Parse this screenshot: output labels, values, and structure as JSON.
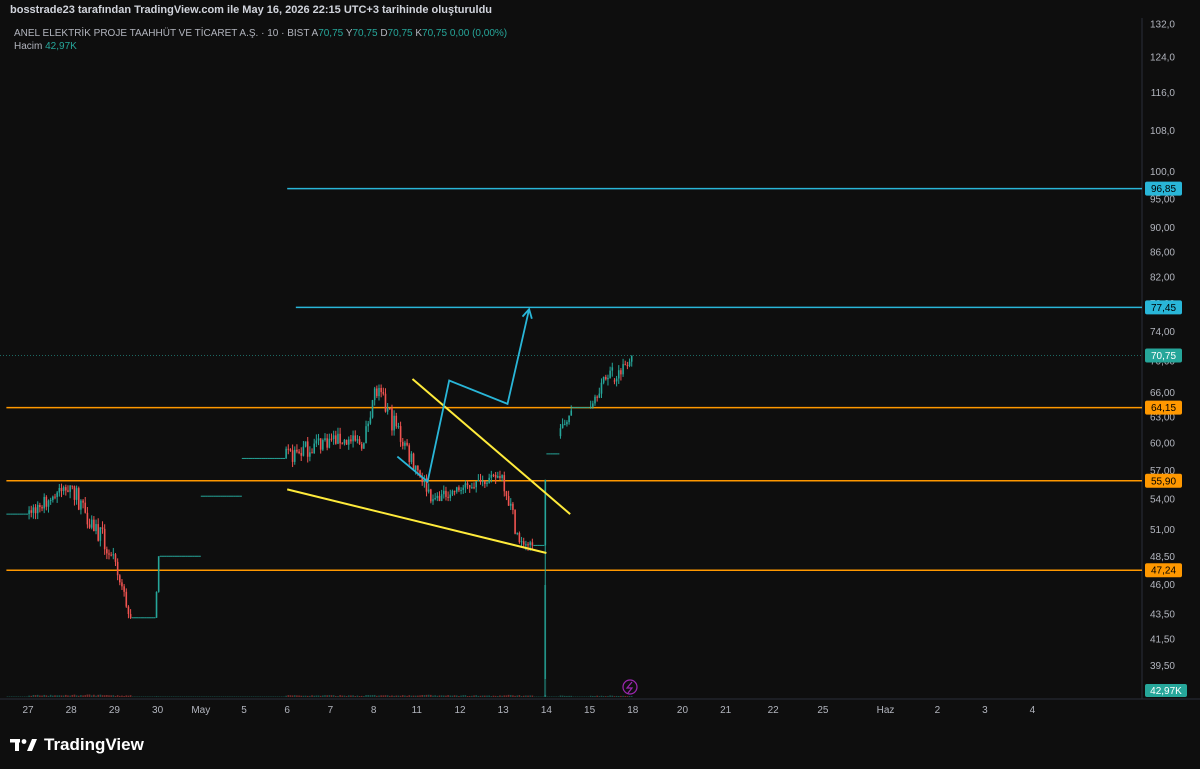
{
  "header": {
    "created_by": "bosstrade23 tarafından TradingView.com ile May 16, 2026 22:15 UTC+3 tarihinde oluşturuldu"
  },
  "legend": {
    "symbol": "ANEL ELEKTRİK PROJE TAAHHÜT VE TİCARET A.Ş. · 10 · BIST",
    "open_label": "A",
    "open": "70,75",
    "high_label": "Y",
    "high": "70,75",
    "low_label": "D",
    "low": "70,75",
    "close_label": "K",
    "close": "70,75",
    "change": "0,00 (0,00%)",
    "volume_label": "Hacim",
    "volume": "42,97K"
  },
  "logo": {
    "text": "TradingView"
  },
  "colors": {
    "background": "#0e0e0e",
    "up": "#26a69a",
    "down": "#ef5350",
    "support_line": "#ff9800",
    "target_line": "#29b6d8",
    "wedge": "#ffeb3b",
    "projection": "#29b6d8"
  },
  "chart_data": {
    "type": "candlestick",
    "symbol": "ANEL",
    "interval": "10",
    "exchange": "BIST",
    "y_scale": "log",
    "ylim": [
      38.5,
      133
    ],
    "y_ticks": [
      {
        "value": 132,
        "label": "132,0"
      },
      {
        "value": 124,
        "label": "124,0"
      },
      {
        "value": 116,
        "label": "116,0"
      },
      {
        "value": 108,
        "label": "108,0"
      },
      {
        "value": 100,
        "label": "100,0"
      },
      {
        "value": 95,
        "label": "95,00"
      },
      {
        "value": 90,
        "label": "90,00"
      },
      {
        "value": 86,
        "label": "86,00"
      },
      {
        "value": 82,
        "label": "82,00"
      },
      {
        "value": 78,
        "label": "78,00"
      },
      {
        "value": 74,
        "label": "74,00"
      },
      {
        "value": 70,
        "label": "70,00"
      },
      {
        "value": 66,
        "label": "66,00"
      },
      {
        "value": 63,
        "label": "63,00"
      },
      {
        "value": 60,
        "label": "60,00"
      },
      {
        "value": 57,
        "label": "57,00"
      },
      {
        "value": 54,
        "label": "54,00"
      },
      {
        "value": 51,
        "label": "51,00"
      },
      {
        "value": 48.5,
        "label": "48,50"
      },
      {
        "value": 46,
        "label": "46,00"
      },
      {
        "value": 43.5,
        "label": "43,50"
      },
      {
        "value": 41.5,
        "label": "41,50"
      },
      {
        "value": 39.5,
        "label": "39,50"
      }
    ],
    "x_ticks": [
      {
        "t": 0,
        "label": "27"
      },
      {
        "t": 1,
        "label": "28"
      },
      {
        "t": 2,
        "label": "29"
      },
      {
        "t": 3,
        "label": "30"
      },
      {
        "t": 4,
        "label": "May"
      },
      {
        "t": 5,
        "label": "5"
      },
      {
        "t": 6,
        "label": "6"
      },
      {
        "t": 7,
        "label": "7"
      },
      {
        "t": 8,
        "label": "8"
      },
      {
        "t": 9,
        "label": "11"
      },
      {
        "t": 10,
        "label": "12"
      },
      {
        "t": 11,
        "label": "13"
      },
      {
        "t": 12,
        "label": "14"
      },
      {
        "t": 13,
        "label": "15"
      },
      {
        "t": 14,
        "label": "18"
      },
      {
        "t": 15.15,
        "label": "20"
      },
      {
        "t": 16.15,
        "label": "21"
      },
      {
        "t": 17.25,
        "label": "22"
      },
      {
        "t": 18.4,
        "label": "25"
      },
      {
        "t": 19.85,
        "label": "Haz"
      },
      {
        "t": 21.05,
        "label": "2"
      },
      {
        "t": 22.15,
        "label": "3"
      },
      {
        "t": 23.25,
        "label": "4"
      }
    ],
    "price_levels": [
      {
        "price": 96.85,
        "label": "96,85",
        "kind": "target",
        "t_start": 6
      },
      {
        "price": 77.45,
        "label": "77,45",
        "kind": "target",
        "t_start": 6.2
      },
      {
        "price": 64.15,
        "label": "64,15",
        "kind": "support",
        "t_start": -0.5
      },
      {
        "price": 55.9,
        "label": "55,90",
        "kind": "support",
        "t_start": -0.5
      },
      {
        "price": 47.24,
        "label": "47,24",
        "kind": "support",
        "t_start": -0.5
      }
    ],
    "last_price": {
      "price": 70.75,
      "label": "70,75"
    },
    "last_volume": {
      "label": "42,97K"
    },
    "wedge_upper": [
      {
        "t": 8.9,
        "p": 67.7
      },
      {
        "t": 12.55,
        "p": 52.5
      }
    ],
    "wedge_lower": [
      {
        "t": 6.0,
        "p": 55.0
      },
      {
        "t": 12.0,
        "p": 48.8
      }
    ],
    "projection_path": [
      {
        "t": 8.55,
        "p": 58.5
      },
      {
        "t": 9.25,
        "p": 55.8
      },
      {
        "t": 9.75,
        "p": 67.5
      },
      {
        "t": 11.1,
        "p": 64.6
      },
      {
        "t": 11.6,
        "p": 77.2
      }
    ],
    "segments": [
      {
        "t0": -0.5,
        "t1": 0.0,
        "p0": 52.5,
        "p1": 52.5,
        "vol": 0.1
      },
      {
        "t0": 0.0,
        "t1": 1.0,
        "p0": 52.5,
        "p1": 55.4,
        "vol": 0.7,
        "lo": 50.5,
        "hi": 56.4
      },
      {
        "t0": 1.0,
        "t1": 1.95,
        "p0": 55.4,
        "p1": 48.6,
        "vol": 0.8,
        "lo": 45.9,
        "hi": 55.4
      },
      {
        "t0": 1.95,
        "t1": 2.4,
        "p0": 48.6,
        "p1": 43.2,
        "vol": 0.6,
        "lo": 43.1,
        "hi": 49.5
      },
      {
        "t0": 2.4,
        "t1": 2.95,
        "p0": 43.2,
        "p1": 43.2,
        "vol": 0.05
      },
      {
        "t0": 2.95,
        "t1": 3.05,
        "p0": 43.2,
        "p1": 48.5,
        "vol": 0.3,
        "lo": 42.8,
        "hi": 48.5
      },
      {
        "t0": 3.05,
        "t1": 4.0,
        "p0": 48.5,
        "p1": 48.5,
        "vol": 0.05
      },
      {
        "t0": 4.0,
        "t1": 4.95,
        "p0": 54.3,
        "p1": 54.3,
        "vol": 0.05
      },
      {
        "t0": 4.95,
        "t1": 5.95,
        "p0": 58.3,
        "p1": 58.3,
        "vol": 0.1
      },
      {
        "t0": 5.95,
        "t1": 7.0,
        "p0": 58.3,
        "p1": 60.5,
        "vol": 0.6,
        "lo": 55.0,
        "hi": 64.2
      },
      {
        "t0": 7.0,
        "t1": 7.8,
        "p0": 60.5,
        "p1": 60.0,
        "vol": 0.6,
        "lo": 57.0,
        "hi": 64.0
      },
      {
        "t0": 7.8,
        "t1": 8.05,
        "p0": 60.0,
        "p1": 66.5,
        "vol": 0.7,
        "lo": 59.0,
        "hi": 67.7
      },
      {
        "t0": 8.05,
        "t1": 9.0,
        "p0": 66.5,
        "p1": 57.5,
        "vol": 0.6,
        "lo": 55.0,
        "hi": 67.0
      },
      {
        "t0": 9.0,
        "t1": 9.4,
        "p0": 57.5,
        "p1": 54.0,
        "vol": 0.7,
        "lo": 52.5,
        "hi": 59.0
      },
      {
        "t0": 9.4,
        "t1": 10.5,
        "p0": 54.0,
        "p1": 55.8,
        "vol": 0.6,
        "lo": 53.8,
        "hi": 58.0
      },
      {
        "t0": 10.5,
        "t1": 11.0,
        "p0": 55.8,
        "p1": 56.5,
        "vol": 0.5,
        "lo": 54.5,
        "hi": 58.0
      },
      {
        "t0": 11.0,
        "t1": 11.4,
        "p0": 56.5,
        "p1": 49.8,
        "vol": 0.7,
        "lo": 49.0,
        "hi": 57.0
      },
      {
        "t0": 11.4,
        "t1": 11.7,
        "p0": 49.8,
        "p1": 49.5,
        "vol": 0.5,
        "lo": 49.0,
        "hi": 51.5
      },
      {
        "t0": 11.7,
        "t1": 11.95,
        "p0": 49.5,
        "p1": 49.5,
        "vol": 0.1
      },
      {
        "t0": 11.95,
        "t1": 12.0,
        "p0": 49.5,
        "p1": 56.0,
        "vol": 1.0,
        "lo": 38.5,
        "hi": 56.0
      },
      {
        "t0": 12.0,
        "t1": 12.3,
        "p0": 58.8,
        "p1": 58.8,
        "vol": 0.1
      },
      {
        "t0": 12.3,
        "t1": 12.6,
        "p0": 60.8,
        "p1": 63.8,
        "vol": 0.5,
        "lo": 60.5,
        "hi": 64.6
      },
      {
        "t0": 12.6,
        "t1": 13.0,
        "p0": 64.15,
        "p1": 64.15,
        "vol": 0.1
      },
      {
        "t0": 13.0,
        "t1": 13.55,
        "p0": 64.2,
        "p1": 69.2,
        "vol": 0.5,
        "lo": 64.0,
        "hi": 70.0
      },
      {
        "t0": 13.55,
        "t1": 14.0,
        "p0": 67.5,
        "p1": 70.75,
        "vol": 0.4,
        "lo": 65.2,
        "hi": 71.2
      }
    ]
  }
}
